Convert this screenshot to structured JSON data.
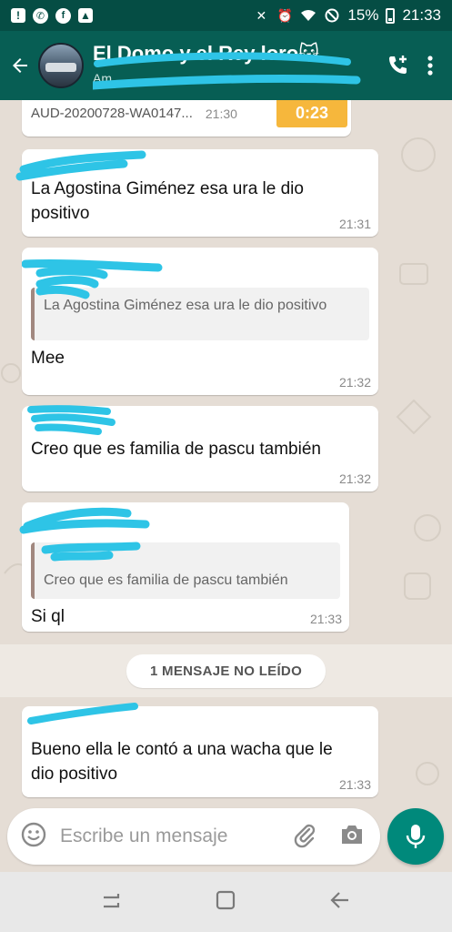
{
  "status_bar": {
    "battery": "15%",
    "time": "21:33"
  },
  "header": {
    "title": "El Domo y el Rey loro🐱",
    "subtitle": "Am…"
  },
  "messages": [
    {
      "type": "audio",
      "file": "AUD-20200728-WA0147...",
      "time": "21:30",
      "duration": "0:23"
    },
    {
      "type": "text",
      "text": "La Agostina Giménez esa ura le dio positivo",
      "time": "21:31"
    },
    {
      "type": "reply",
      "quote": "La Agostina Giménez esa ura le dio positivo",
      "text": "Mee",
      "time": "21:32"
    },
    {
      "type": "text",
      "text": "Creo que es familia de pascu también",
      "time": "21:32"
    },
    {
      "type": "reply",
      "quote": "Creo que es familia de pascu también",
      "text": "Si ql",
      "time": "21:33"
    },
    {
      "type": "text",
      "text": "Bueno ella le contó a una wacha que le dio positivo",
      "time": "21:33"
    }
  ],
  "unread_banner": "1 MENSAJE NO LEÍDO",
  "composer": {
    "placeholder": "Escribe un mensaje"
  },
  "colors": {
    "header": "#075e54",
    "status_bar": "#054d44",
    "accent_fab": "#00897b",
    "audio_badge": "#f6b73c",
    "quote_bar": "#a1887f",
    "redaction": "#2ec4e6"
  },
  "icons": {
    "back": "arrow-left-icon",
    "add_call": "add-call-icon",
    "menu": "more-vert-icon",
    "emoji": "emoji-icon",
    "attach": "paperclip-icon",
    "camera": "camera-icon",
    "mic": "mic-icon"
  }
}
